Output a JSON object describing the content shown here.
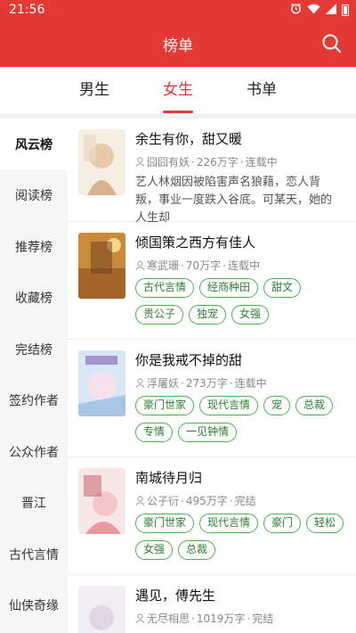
{
  "status_bar": {
    "time": "21:56"
  },
  "header": {
    "title": "榜单"
  },
  "tabs": [
    {
      "label": "男生",
      "active": false
    },
    {
      "label": "女生",
      "active": true
    },
    {
      "label": "书单",
      "active": false
    }
  ],
  "sidebar": [
    {
      "label": "风云榜",
      "active": true
    },
    {
      "label": "阅读榜"
    },
    {
      "label": "推荐榜"
    },
    {
      "label": "收藏榜"
    },
    {
      "label": "完结榜"
    },
    {
      "label": "签约作者"
    },
    {
      "label": "公众作者"
    },
    {
      "label": "晋江"
    },
    {
      "label": "古代言情"
    },
    {
      "label": "仙侠奇缘"
    }
  ],
  "books": [
    {
      "title": "余生有你，甜又暖",
      "author": "囧囧有妖",
      "words": "226万字",
      "status": "连载中",
      "description": "艺人林烟因被陷害声名狼藉，恋人背叛，事业一度跌入谷底。可某天，她的人生却",
      "tags": []
    },
    {
      "title": "倾国策之西方有佳人",
      "author": "寒武珊",
      "words": "70万字",
      "status": "连载中",
      "description": "",
      "tags": [
        "古代言情",
        "经商种田",
        "甜文",
        "贵公子",
        "独宠",
        "女强"
      ]
    },
    {
      "title": "你是我戒不掉的甜",
      "author": "浮屠妖",
      "words": "273万字",
      "status": "连载中",
      "description": "",
      "tags": [
        "豪门世家",
        "现代言情",
        "宠",
        "总裁",
        "专情",
        "一见钟情"
      ]
    },
    {
      "title": "南城待月归",
      "author": "公子衍",
      "words": "495万字",
      "status": "完结",
      "description": "",
      "tags": [
        "豪门世家",
        "现代言情",
        "豪门",
        "轻松",
        "女强",
        "总裁"
      ]
    },
    {
      "title": "遇见，傅先生",
      "author": "无尽相思",
      "words": "1019万字",
      "status": "完结",
      "description": "",
      "tags": []
    }
  ],
  "colors": {
    "accent": "#e53935",
    "tag_green": "#4caf50"
  }
}
